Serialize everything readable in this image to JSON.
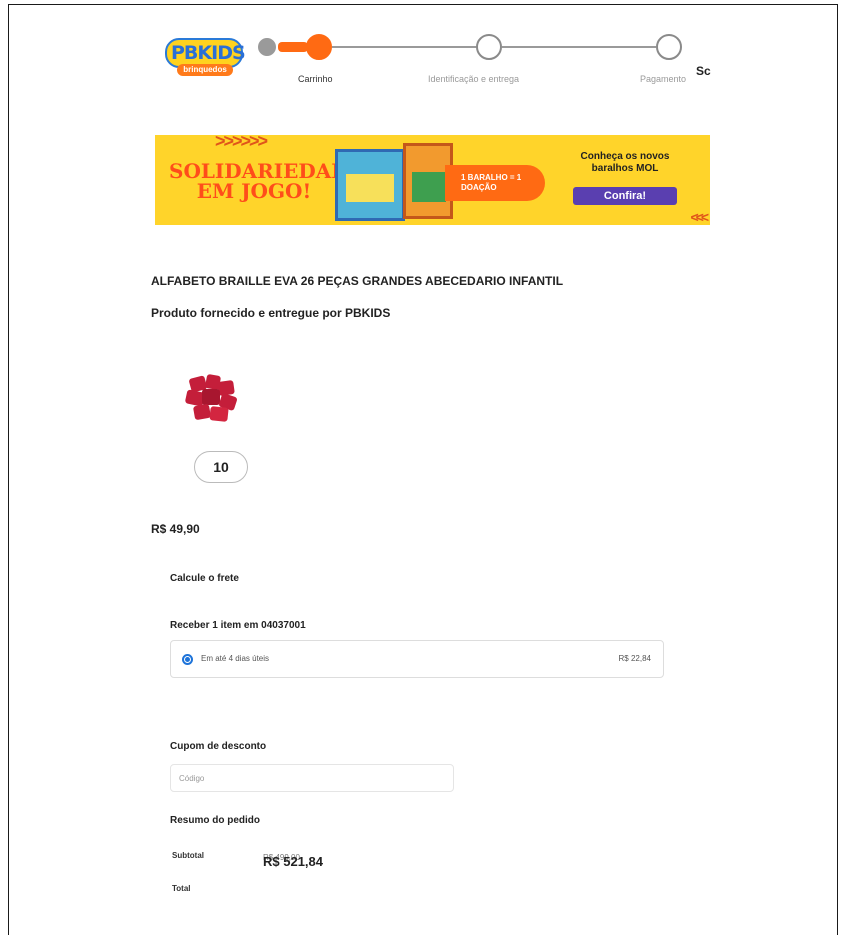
{
  "header": {
    "logo_text": "PBKIDS",
    "logo_sub": "brinquedos",
    "steps": [
      {
        "label": "Carrinho",
        "active": true
      },
      {
        "label": "Identificação e entrega",
        "active": false
      },
      {
        "label": "Pagamento",
        "active": false
      }
    ],
    "cut_text": "Sc"
  },
  "banner": {
    "chevrons_top": ">>>>>>",
    "headline": "SOLIDARIEDADE EM JOGO!",
    "pill_text": "1 BARALHO = 1 DOAÇÃO",
    "cta_text": "Conheça os novos baralhos MOL",
    "cta_button": "Confira!",
    "chevrons_bottom": "<<<",
    "colors": {
      "background": "#ffd42a",
      "headline": "#ff4d1a",
      "button": "#5a3fb0"
    }
  },
  "product": {
    "title": "ALFABETO BRAILLE EVA 26 PEÇAS GRANDES ABECEDARIO INFANTIL",
    "seller": "Produto fornecido e entregue por PBKIDS",
    "quantity": "10",
    "price": "R$ 49,90",
    "image_icon": "product-blocks-icon"
  },
  "freight": {
    "heading": "Calcule o frete",
    "receive_label": "Receber 1 item em 04037001",
    "option_label": "Em até 4 dias úteis",
    "option_price": "R$ 22,84"
  },
  "coupon": {
    "heading": "Cupom de desconto",
    "placeholder": "Código"
  },
  "summary": {
    "heading": "Resumo do pedido",
    "subtotal_label": "Subtotal",
    "subtotal_value": "R$ 499,00",
    "total_label": "Total",
    "total_value": "R$ 521,84"
  }
}
